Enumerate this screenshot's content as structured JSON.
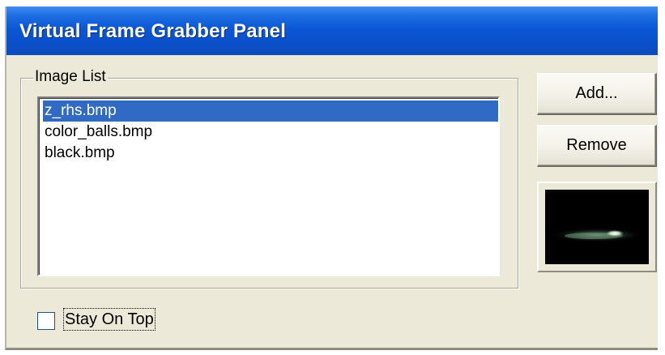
{
  "window": {
    "title": "Virtual Frame Grabber Panel"
  },
  "image_list": {
    "label": "Image List",
    "items": [
      {
        "label": "z_rhs.bmp",
        "selected": true
      },
      {
        "label": "color_balls.bmp",
        "selected": false
      },
      {
        "label": "black.bmp",
        "selected": false
      }
    ]
  },
  "buttons": {
    "add_label": "Add...",
    "remove_label": "Remove"
  },
  "preview": {
    "icon": "image-preview"
  },
  "options": {
    "stay_on_top_label": "Stay On Top",
    "stay_on_top_checked": false
  },
  "colors": {
    "titlebar": "#0a4fc9",
    "selection": "#316ac5",
    "dialog_bg": "#ece9d8"
  }
}
